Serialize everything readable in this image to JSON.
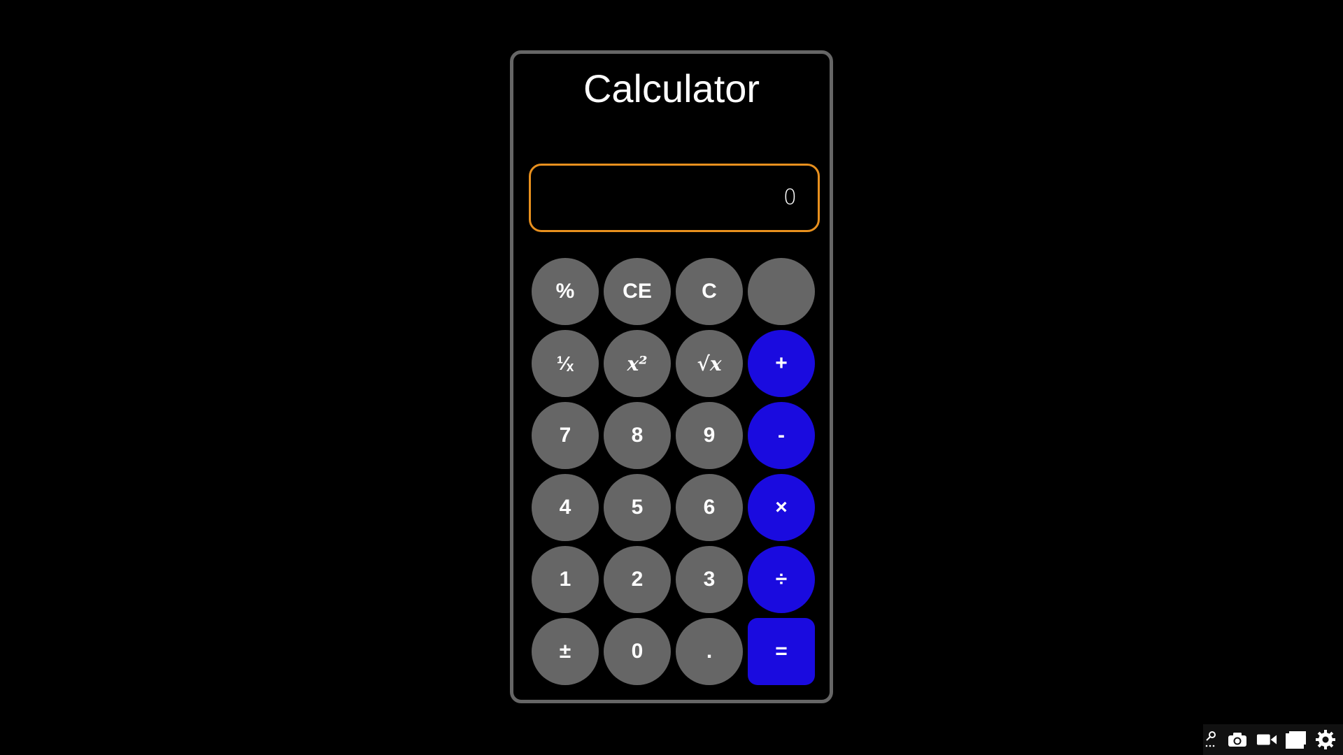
{
  "app": {
    "title": "Calculator",
    "display_value": "0"
  },
  "keys": [
    {
      "label": "%",
      "type": "fn"
    },
    {
      "label": "CE",
      "type": "fn"
    },
    {
      "label": "C",
      "type": "fn"
    },
    {
      "label": "",
      "type": "fn"
    },
    {
      "label": "¹⁄ₓ",
      "type": "fn"
    },
    {
      "label": "x²",
      "type": "fn"
    },
    {
      "label": "√x",
      "type": "fn"
    },
    {
      "label": "+",
      "type": "op"
    },
    {
      "label": "7",
      "type": "num"
    },
    {
      "label": "8",
      "type": "num"
    },
    {
      "label": "9",
      "type": "num"
    },
    {
      "label": "-",
      "type": "op"
    },
    {
      "label": "4",
      "type": "num"
    },
    {
      "label": "5",
      "type": "num"
    },
    {
      "label": "6",
      "type": "num"
    },
    {
      "label": "×",
      "type": "op"
    },
    {
      "label": "1",
      "type": "num"
    },
    {
      "label": "2",
      "type": "num"
    },
    {
      "label": "3",
      "type": "num"
    },
    {
      "label": "÷",
      "type": "op"
    },
    {
      "label": "±",
      "type": "fn"
    },
    {
      "label": "0",
      "type": "num"
    },
    {
      "label": ".",
      "type": "num"
    },
    {
      "label": "=",
      "type": "op"
    }
  ],
  "toolbar": {
    "icons": [
      "pin-icon",
      "camera-icon",
      "video-camera-icon",
      "window-icon",
      "gear-icon"
    ]
  },
  "colors": {
    "background": "#000000",
    "frame_border": "#666666",
    "display_border": "#e8901e",
    "key_gray": "#666666",
    "key_blue": "#1a0bdf",
    "text": "#ffffff"
  }
}
